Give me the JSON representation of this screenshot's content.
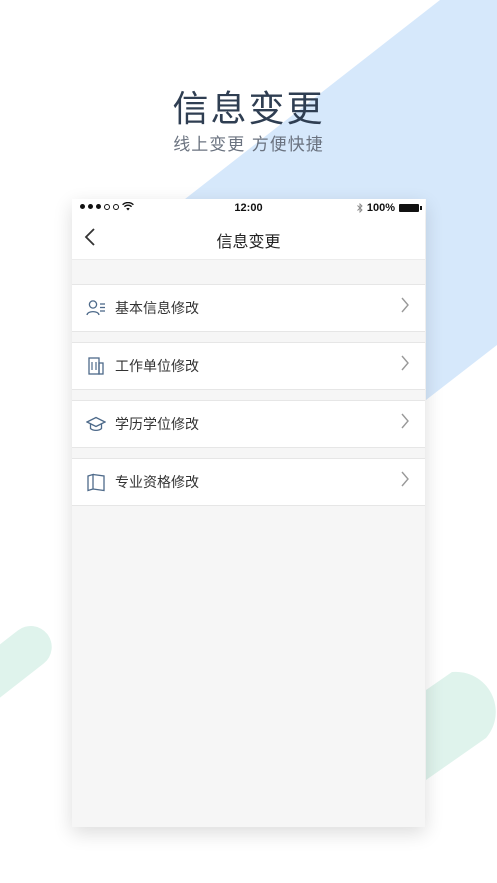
{
  "hero": {
    "title": "信息变更",
    "subtitle": "线上变更  方便快捷"
  },
  "status_bar": {
    "time": "12:00",
    "battery": "100%",
    "icons": [
      "signal-dots-icon",
      "wifi-icon",
      "bluetooth-icon",
      "battery-icon"
    ]
  },
  "nav": {
    "back_icon": "chevron-left-icon",
    "title": "信息变更"
  },
  "menu": {
    "items": [
      {
        "label": "基本信息修改",
        "icon": "user-profile-icon"
      },
      {
        "label": "工作单位修改",
        "icon": "building-icon"
      },
      {
        "label": "学历学位修改",
        "icon": "graduation-cap-icon"
      },
      {
        "label": "专业资格修改",
        "icon": "book-icon"
      }
    ]
  },
  "colors": {
    "accent_blue": "#d6e8fb",
    "accent_green": "#dff3ec",
    "icon_color": "#4e6a8a"
  }
}
